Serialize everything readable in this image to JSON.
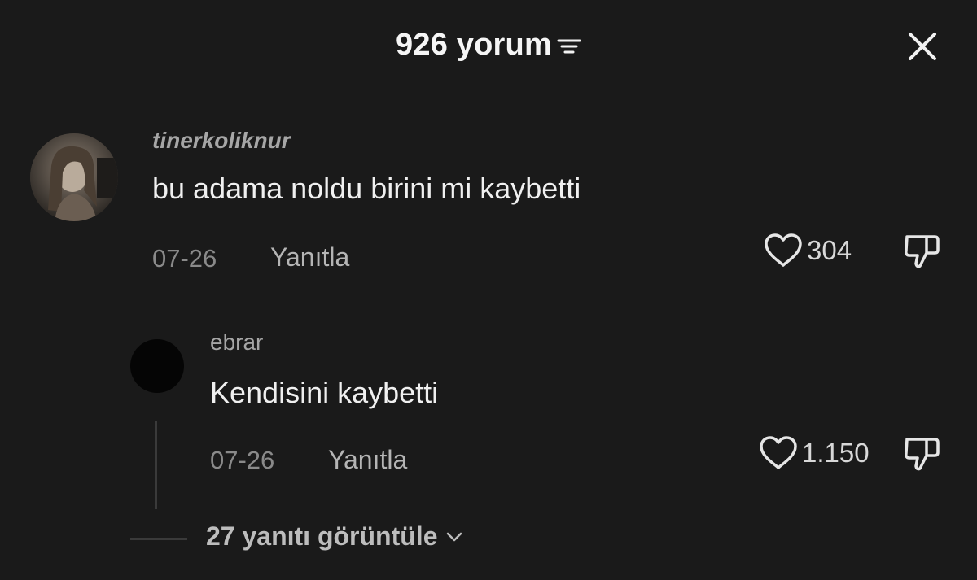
{
  "header": {
    "title": "926 yorum",
    "sort_icon": "sort-lines-icon",
    "close_icon": "close-x-icon"
  },
  "comments": [
    {
      "username": "tinerkoliknur",
      "text": "bu adama noldu birini mi kaybetti",
      "date": "07-26",
      "reply_label": "Yanıtla",
      "likes": "304"
    }
  ],
  "replies": [
    {
      "username": "ebrar",
      "text": "Kendisini kaybetti",
      "date": "07-26",
      "reply_label": "Yanıtla",
      "likes": "1.150"
    }
  ],
  "view_more": {
    "label": "27 yanıtı görüntüle"
  },
  "colors": {
    "background": "#1a1a1a",
    "primary_text": "#f0f0f0",
    "secondary_text": "#a6a6a6"
  }
}
